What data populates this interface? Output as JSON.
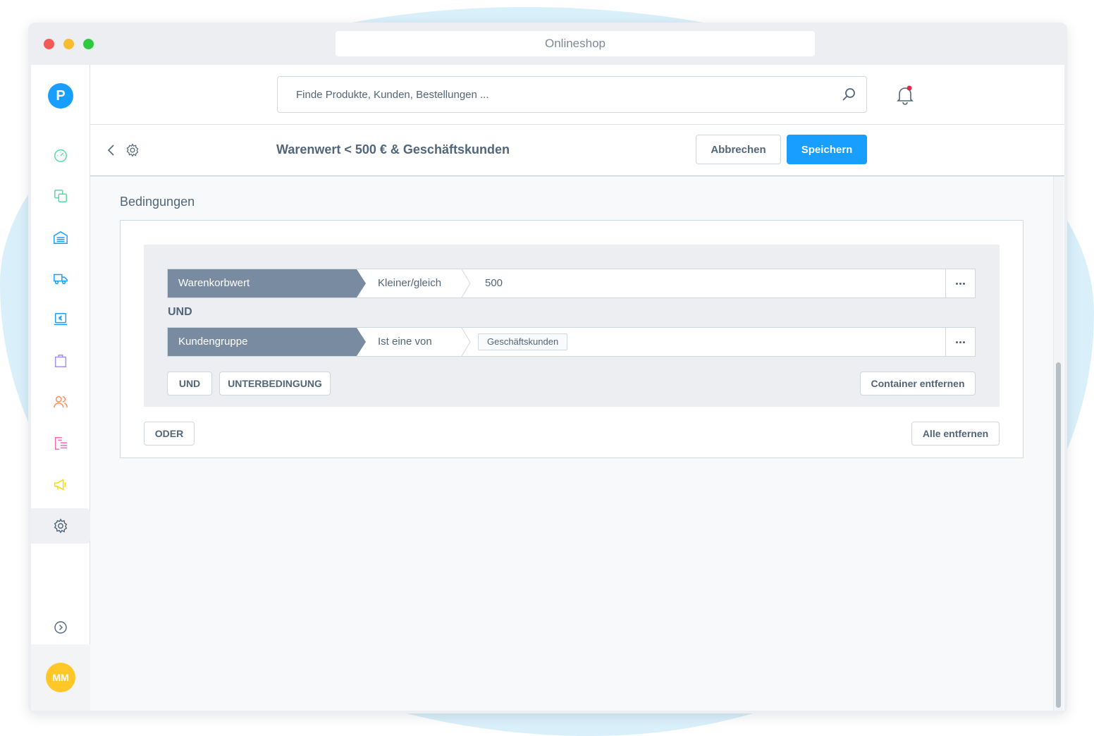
{
  "window": {
    "title": "Onlineshop"
  },
  "sidebar": {
    "logo_letter": "P",
    "items": [
      {
        "icon": "dashboard-icon",
        "color": "#57d9a3"
      },
      {
        "icon": "catalog-icon",
        "color": "#57d9a3"
      },
      {
        "icon": "warehouse-icon",
        "color": "#189eff"
      },
      {
        "icon": "shipping-icon",
        "color": "#189eff"
      },
      {
        "icon": "payment-icon",
        "color": "#189eff"
      },
      {
        "icon": "orders-icon",
        "color": "#a092f0"
      },
      {
        "icon": "customers-icon",
        "color": "#ff8c5a"
      },
      {
        "icon": "content-icon",
        "color": "#ff68b4"
      },
      {
        "icon": "marketing-icon",
        "color": "#ffd700"
      },
      {
        "icon": "settings-icon",
        "color": "#52667a",
        "active": true
      }
    ],
    "user_initials": "MM"
  },
  "search": {
    "placeholder": "Finde Produkte, Kunden, Bestellungen ..."
  },
  "smartbar": {
    "title": "Warenwert < 500 € & Geschäftskunden",
    "cancel_label": "Abbrechen",
    "save_label": "Speichern"
  },
  "conditions": {
    "section_title": "Bedingungen",
    "rows": [
      {
        "field": "Warenkorbwert",
        "operator": "Kleiner/gleich",
        "value": "500"
      },
      {
        "field": "Kundengruppe",
        "operator": "Ist eine von",
        "tag": "Geschäftskunden"
      }
    ],
    "connector": "UND",
    "and_button": "UND",
    "sub_button": "UNTERBEDINGUNG",
    "remove_container": "Container entfernen",
    "or_button": "ODER",
    "remove_all": "Alle entfernen"
  },
  "colors": {
    "primary": "#189eff",
    "field_chip": "#798ba0",
    "text": "#52667a",
    "avatar": "#ffc828"
  }
}
